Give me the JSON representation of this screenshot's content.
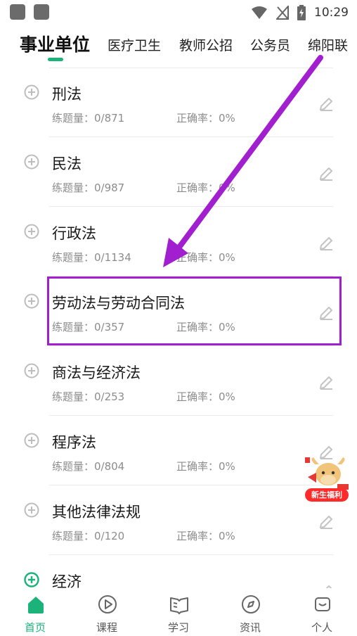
{
  "status_bar": {
    "time": "10:29"
  },
  "tabs": [
    {
      "label": "事业单位",
      "active": true
    },
    {
      "label": "医疗卫生"
    },
    {
      "label": "教师公招"
    },
    {
      "label": "公务员"
    },
    {
      "label": "绵阳联"
    }
  ],
  "items": [
    {
      "title": "刑法",
      "practice": "练题量：0/871",
      "accuracy": "正确率：0%"
    },
    {
      "title": "民法",
      "practice": "练题量：0/987",
      "accuracy": "正确率：0%"
    },
    {
      "title": "行政法",
      "practice": "练题量：0/1134",
      "accuracy": "正确率：0%"
    },
    {
      "title": "劳动法与劳动合同法",
      "practice": "练题量：0/357",
      "accuracy": "正确率：0%"
    },
    {
      "title": "商法与经济法",
      "practice": "练题量：0/253",
      "accuracy": "正确率：0%"
    },
    {
      "title": "程序法",
      "practice": "练题量：0/804",
      "accuracy": "正确率：0%"
    },
    {
      "title": "其他法律法规",
      "practice": "练题量：0/120",
      "accuracy": "正确率：0%"
    },
    {
      "title": "经济",
      "practice": "",
      "accuracy": ""
    }
  ],
  "promo": {
    "label": "新生福利"
  },
  "bottom_nav": [
    {
      "label": "首页",
      "icon": "home-icon",
      "active": true
    },
    {
      "label": "课程",
      "icon": "play-circle-icon"
    },
    {
      "label": "学习",
      "icon": "book-icon"
    },
    {
      "label": "资讯",
      "icon": "compass-icon"
    },
    {
      "label": "个人",
      "icon": "person-icon"
    }
  ],
  "colors": {
    "accent": "#1bb37a",
    "highlight": "#a21fcf"
  }
}
